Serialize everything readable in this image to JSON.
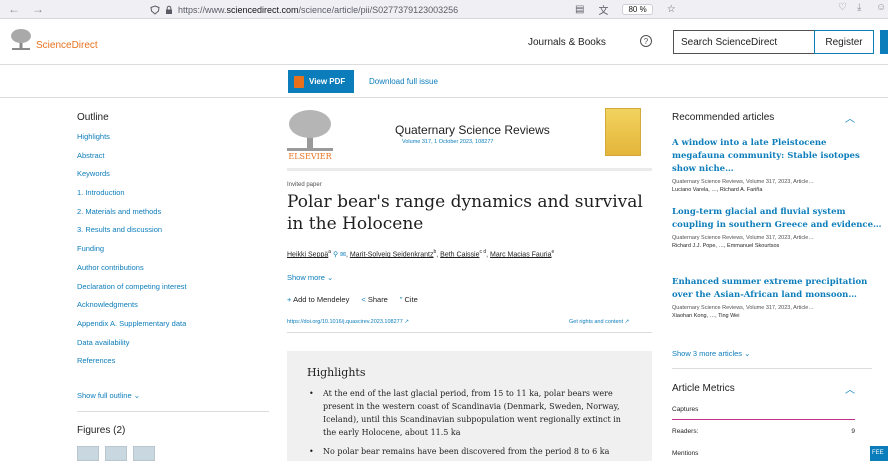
{
  "browser": {
    "url_prefix": "https://www.",
    "url_domain": "sciencedirect.com",
    "url_path": "/science/article/pii/S0277379123003256",
    "zoom": "80 %"
  },
  "header": {
    "brand": "ScienceDirect",
    "journals_books": "Journals & Books",
    "help": "?",
    "search_placeholder": "Search ScienceDirect",
    "register": "Register"
  },
  "toolbar": {
    "view_pdf": "View PDF",
    "download_full_issue": "Download full issue"
  },
  "outline": {
    "title": "Outline",
    "items": [
      "Highlights",
      "Abstract",
      "Keywords",
      "1. Introduction",
      "2. Materials and methods",
      "3. Results and discussion",
      "Funding",
      "Author contributions",
      "Declaration of competing interest",
      "Acknowledgments",
      "Appendix A. Supplementary data",
      "Data availability",
      "References"
    ],
    "show_full": "Show full outline",
    "figures": "Figures (2)"
  },
  "article": {
    "journal": "Quaternary Science Reviews",
    "volume_link": "Volume 317",
    "volume_rest": ", 1 October 2023, 108277",
    "invited": "Invited paper",
    "title": "Polar bear's range dynamics and survival in the Holocene",
    "authors": [
      {
        "name": "Heikki Seppä",
        "sup": "a"
      },
      {
        "name": "Marit-Solveig Seidenkrantz",
        "sup": "b"
      },
      {
        "name": "Beth Caissie",
        "sup": "c d"
      },
      {
        "name": "Marc Macias Fauria",
        "sup": "e"
      }
    ],
    "show_more": "Show more",
    "actions": {
      "add": "Add to Mendeley",
      "share": "Share",
      "cite": "Cite"
    },
    "doi": "https://doi.org/10.1016/j.quascirev.2023.108277",
    "rights": "Get rights and content",
    "highlights_title": "Highlights",
    "highlights": [
      "At the end of the last glacial period, from 15 to 11 ka, polar bears were present in the western coast of Scandinavia (Denmark, Sweden, Norway, Iceland), until this Scandinavian subpopulation went regionally extinct in the early Holocene, about 11.5 ka",
      "No polar bear remains have been discovered from the period 8 to 6 ka"
    ]
  },
  "recommended": {
    "title": "Recommended articles",
    "items": [
      {
        "title": "A window into a late Pleistocene megafauna community: Stable isotopes show niche…",
        "meta": "Quaternary Science Reviews, Volume 317, 2023, Article…",
        "authors": "Luciano Varela, …, Richard A. Fariña"
      },
      {
        "title": "Long-term glacial and fluvial system coupling in southern Greece and evidence…",
        "meta": "Quaternary Science Reviews, Volume 317, 2023, Article…",
        "authors": "Richard J.J. Pope, …, Emmanuel Skourtsos"
      },
      {
        "title": "Enhanced summer extreme precipitation over the Asian-African land monsoon…",
        "meta": "Quaternary Science Reviews, Volume 317, 2023, Article…",
        "authors": "Xiaohan Kong, …, Ting Wei"
      }
    ],
    "show_more": "Show 3 more articles"
  },
  "metrics": {
    "title": "Article Metrics",
    "captures": "Captures",
    "readers_label": "Readers:",
    "readers_value": "9",
    "mentions": "Mentions"
  },
  "feedback": "FEE"
}
